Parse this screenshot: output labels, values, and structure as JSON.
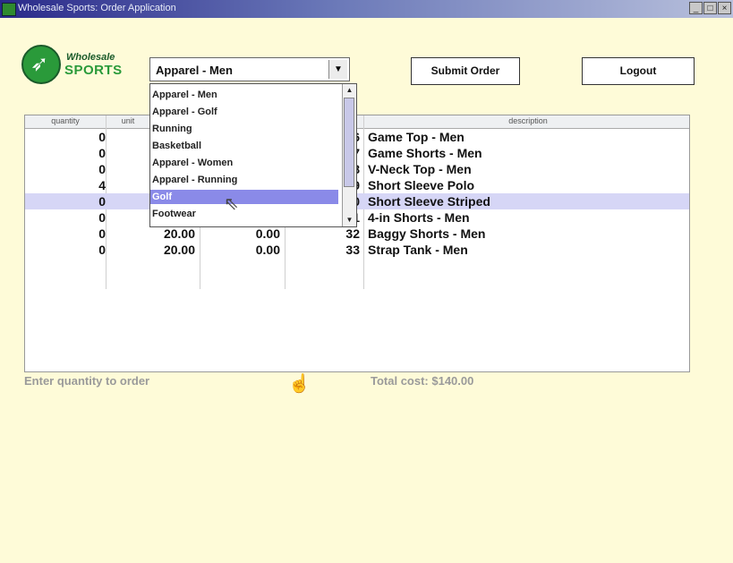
{
  "window": {
    "title": "Wholesale Sports: Order Application",
    "minimize": "_",
    "maximize": "□",
    "close": "×"
  },
  "logo": {
    "line1": "Wholesale",
    "line2": "SPORTS"
  },
  "category_select": {
    "selected": "Apparel - Men",
    "options": [
      "Apparel - Men",
      "Apparel - Golf",
      "Running",
      "Basketball",
      "Apparel - Women",
      "Apparel - Running",
      "Golf",
      "Footwear"
    ],
    "highlighted": "Golf"
  },
  "buttons": {
    "submit": "Submit Order",
    "logout": "Logout"
  },
  "table": {
    "headers": [
      "quantity",
      "unit",
      "",
      "#",
      "description"
    ],
    "rows": [
      {
        "quantity": "0",
        "unit": "",
        "total": "",
        "item": "26",
        "description": "Game Top - Men",
        "selected": false
      },
      {
        "quantity": "0",
        "unit": "",
        "total": "",
        "item": "27",
        "description": "Game Shorts - Men",
        "selected": false
      },
      {
        "quantity": "0",
        "unit": "",
        "total": "",
        "item": "28",
        "description": "V-Neck Top - Men",
        "selected": false
      },
      {
        "quantity": "4",
        "unit": "",
        "total": "",
        "item": "29",
        "description": "Short Sleeve Polo",
        "selected": false
      },
      {
        "quantity": "0",
        "unit": "",
        "total": "",
        "item": "30",
        "description": "Short Sleeve Striped",
        "selected": true
      },
      {
        "quantity": "0",
        "unit": "20.00",
        "total": "0.00",
        "item": "31",
        "description": "4-in Shorts - Men",
        "selected": false
      },
      {
        "quantity": "0",
        "unit": "20.00",
        "total": "0.00",
        "item": "32",
        "description": "Baggy Shorts - Men",
        "selected": false
      },
      {
        "quantity": "0",
        "unit": "20.00",
        "total": "0.00",
        "item": "33",
        "description": "Strap Tank - Men",
        "selected": false
      }
    ]
  },
  "status": {
    "hint": "Enter quantity to order",
    "total": "Total cost: $140.00"
  },
  "colors": {
    "background": "#fefbd8",
    "highlight": "#8a8ae8",
    "selected_row": "#d6d6f6"
  },
  "icons": {
    "dropdown": "chevron-down-icon",
    "cursor": "arrow-cursor-icon"
  }
}
